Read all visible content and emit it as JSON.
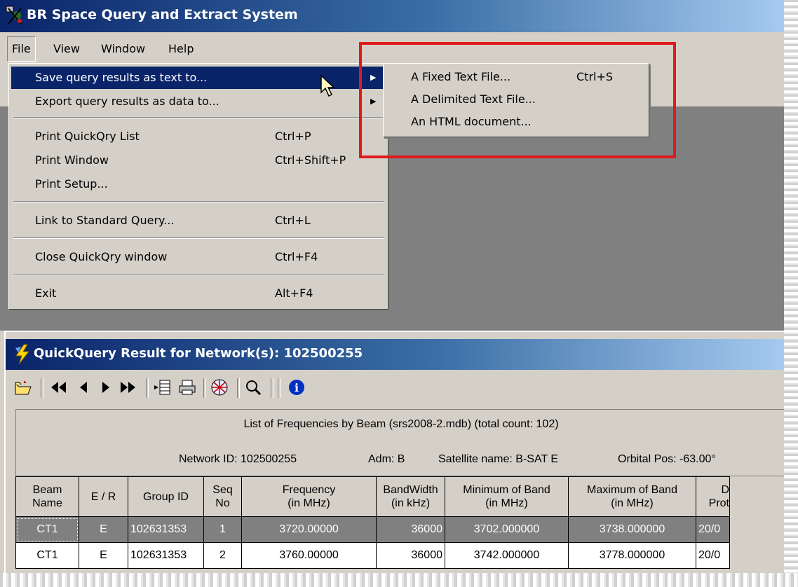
{
  "window": {
    "title": "BR Space Query and Extract System",
    "icon": "app-icon",
    "accent": "#0a246a"
  },
  "menubar": {
    "items": [
      "File",
      "View",
      "Window",
      "Help"
    ],
    "active": "File"
  },
  "file_menu": {
    "items": [
      {
        "label": "Save query results as text to...",
        "shortcut": "",
        "submenu": true,
        "highlighted": true
      },
      {
        "label": "Export query results as data to...",
        "shortcut": "",
        "submenu": true
      },
      {
        "label": "Print QuickQry List",
        "shortcut": "Ctrl+P"
      },
      {
        "label": "Print Window",
        "shortcut": "Ctrl+Shift+P"
      },
      {
        "label": "Print Setup...",
        "shortcut": ""
      },
      {
        "label": "Link to Standard Query...",
        "shortcut": "Ctrl+L"
      },
      {
        "label": "Close QuickQry window",
        "shortcut": "Ctrl+F4"
      },
      {
        "label": "Exit",
        "shortcut": "Alt+F4"
      }
    ]
  },
  "save_submenu": {
    "items": [
      {
        "label": "A Fixed Text File...",
        "shortcut": "Ctrl+S"
      },
      {
        "label": "A Delimited Text File...",
        "shortcut": ""
      },
      {
        "label": "An HTML document...",
        "shortcut": ""
      }
    ],
    "highlight_box_color": "#e0191b"
  },
  "child_window": {
    "title": "QuickQuery Result for Network(s): 102500255",
    "icon": "lightning-icon",
    "toolbar_icons": [
      "open-folder-icon",
      "first-record-icon",
      "previous-record-icon",
      "next-record-icon",
      "last-record-icon",
      "insert-column-icon",
      "print-icon",
      "globe-icon",
      "search-icon",
      "info-icon"
    ],
    "info_line1": "List of Frequencies by Beam  (srs2008-2.mdb)  (total count: 102)",
    "info_line2": {
      "network": "Network ID: 102500255",
      "adm": "Adm: B",
      "satellite": "Satellite name: B-SAT E",
      "orbital": "Orbital Pos: -63.00°"
    }
  },
  "table": {
    "columns": [
      {
        "l1": "Beam",
        "l2": "Name"
      },
      {
        "l1": "E / R",
        "l2": ""
      },
      {
        "l1": "Group ID",
        "l2": ""
      },
      {
        "l1": "Seq",
        "l2": "No"
      },
      {
        "l1": "Frequency",
        "l2": "(in MHz)"
      },
      {
        "l1": "BandWidth",
        "l2": "(in kHz)"
      },
      {
        "l1": "Minimum of Band",
        "l2": "(in MHz)"
      },
      {
        "l1": "Maximum of Band",
        "l2": "(in MHz)"
      },
      {
        "l1": "D",
        "l2": "Prot"
      }
    ],
    "rows": [
      {
        "beam": "CT1",
        "er": "E",
        "group": "102631353",
        "seq": "1",
        "freq": "3720.00000",
        "bw": "36000",
        "min": "3702.000000",
        "max": "3738.000000",
        "d": "20/0",
        "selected": true
      },
      {
        "beam": "CT1",
        "er": "E",
        "group": "102631353",
        "seq": "2",
        "freq": "3760.00000",
        "bw": "36000",
        "min": "3742.000000",
        "max": "3778.000000",
        "d": "20/0"
      }
    ]
  }
}
